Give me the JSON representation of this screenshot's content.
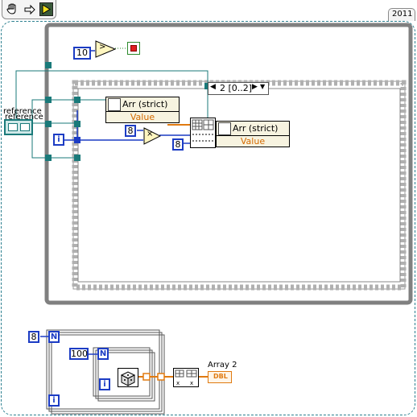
{
  "toolbar": {
    "hand_icon": "hand-tool-icon",
    "arrow_icon": "arrow-tool-icon",
    "run_icon": "run-arrow-icon"
  },
  "version_label": "2011",
  "while_loop": {
    "count_constant": "10",
    "stop_icon": "stop-terminal-icon"
  },
  "control": {
    "label": "reference"
  },
  "iteration_terminal": "i",
  "case_structure": {
    "selector_label": "2 [0..2]",
    "left_arrow": "◀",
    "right_arrow": "▶",
    "dropdown_arrow": "▼"
  },
  "property_node_1": {
    "property": "Arr (strict)",
    "value": "Value"
  },
  "property_node_2": {
    "property": "Arr (strict)",
    "value": "Value"
  },
  "multiply_constant": "8",
  "multiply_symbol": "×",
  "compare_symbol": ">",
  "reshape_constant": "8",
  "outer_for_loop": {
    "count_constant": "8",
    "n_terminal": "N",
    "i_terminal": "i"
  },
  "inner_for_loop": {
    "count_constant": "100",
    "n_terminal": "N",
    "i_terminal": "i",
    "dice_icon": "random-number-dice-icon"
  },
  "indicator": {
    "label": "Array 2",
    "type": "DBL"
  },
  "colors": {
    "wire_teal": "#1a7a7a",
    "wire_blue": "#1c3cc4",
    "wire_orange": "#e07a10",
    "structure_gray": "#808080",
    "border_dash": "#2a7f8f"
  }
}
